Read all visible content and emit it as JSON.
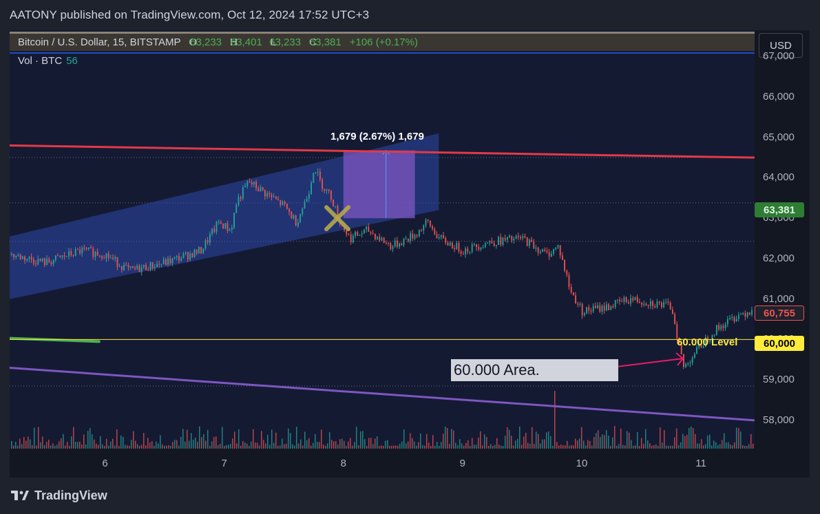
{
  "header": {
    "title": "AATONY published on TradingView.com, Oct 12, 2024 17:52 UTC+3"
  },
  "legend": {
    "symbol": "Bitcoin / U.S. Dollar, 15, BITSTAMP",
    "o_label": "O",
    "o_value": "63,233",
    "h_label": "H",
    "h_value": "63,401",
    "l_label": "L",
    "l_value": "63,233",
    "c_label": "C",
    "c_value": "63,381",
    "change": "+106 (+0.17%)"
  },
  "volume_legend": {
    "label": "Vol · BTC",
    "value": "56"
  },
  "currency_button": "USD",
  "price_ticks": [
    "67,000",
    "66,000",
    "65,000",
    "64,000",
    "63,000",
    "62,000",
    "61,000",
    "60,000",
    "59,000",
    "58,000"
  ],
  "time_ticks": [
    "6",
    "7",
    "8",
    "9",
    "10",
    "11"
  ],
  "badges": {
    "current": "63,381",
    "level_red": "60,755",
    "level_yellow": "60,000"
  },
  "annotations": {
    "measure": "1,679 (2.67%) 1,679",
    "level_60k": "60.000 Level",
    "area_note": "60.000 Area."
  },
  "footer": {
    "brand": "TradingView"
  },
  "colors": {
    "up": "#26a69a",
    "down": "#ef5350",
    "resistance_line": "#e53946",
    "support_line": "#7e57c2",
    "green_line": "#4caf50",
    "level_line": "#ffeb3b",
    "channel_fill": "#2c49a8",
    "measure_box": "#7e57c2",
    "arrow": "#e91e63",
    "cross": "#b6a84a"
  },
  "chart_data": {
    "type": "candlestick",
    "symbol": "BTC/USD",
    "timeframe": "15",
    "exchange": "BITSTAMP",
    "x_range_days": [
      5.2,
      11.45
    ],
    "y_range": [
      57300,
      67650
    ],
    "current_price": 63381,
    "price_path": [
      [
        5.2,
        62100
      ],
      [
        5.5,
        61900
      ],
      [
        5.8,
        62200
      ],
      [
        6.0,
        62100
      ],
      [
        6.2,
        61700
      ],
      [
        6.5,
        61900
      ],
      [
        6.8,
        62200
      ],
      [
        6.95,
        62900
      ],
      [
        7.05,
        62700
      ],
      [
        7.1,
        63400
      ],
      [
        7.2,
        63900
      ],
      [
        7.35,
        63600
      ],
      [
        7.5,
        63300
      ],
      [
        7.6,
        62900
      ],
      [
        7.7,
        63600
      ],
      [
        7.75,
        64300
      ],
      [
        7.8,
        63900
      ],
      [
        7.9,
        63500
      ],
      [
        7.95,
        63000
      ],
      [
        8.05,
        62500
      ],
      [
        8.2,
        62700
      ],
      [
        8.4,
        62300
      ],
      [
        8.6,
        62600
      ],
      [
        8.7,
        62900
      ],
      [
        8.8,
        62500
      ],
      [
        9.0,
        62200
      ],
      [
        9.2,
        62400
      ],
      [
        9.5,
        62500
      ],
      [
        9.7,
        62100
      ],
      [
        9.8,
        62300
      ],
      [
        9.9,
        61200
      ],
      [
        10.0,
        60700
      ],
      [
        10.2,
        60800
      ],
      [
        10.4,
        61000
      ],
      [
        10.6,
        60900
      ],
      [
        10.75,
        60800
      ],
      [
        10.85,
        59300
      ],
      [
        10.95,
        59700
      ],
      [
        11.1,
        60200
      ],
      [
        11.3,
        60600
      ],
      [
        11.45,
        60755
      ]
    ],
    "horizontal_levels": [
      {
        "price": 60000,
        "label": "60.000 Level"
      }
    ],
    "trendlines": [
      {
        "name": "",
        "from": [
          5.2,
          64800
        ],
        "to": [
          11.45,
          64500
        ]
      },
      {
        "name": "",
        "from": [
          5.2,
          59300
        ],
        "to": [
          11.45,
          58000
        ]
      },
      {
        "name": "",
        "from": [
          5.2,
          60030
        ],
        "to": [
          5.95,
          59950
        ]
      }
    ],
    "channel": {
      "from_x": 5.2,
      "to_x": 8.8,
      "lower_start": 61000,
      "lower_end": 63200,
      "upper_start": 62550,
      "upper_end": 65100
    },
    "measure": {
      "x0": 8.0,
      "x1": 8.6,
      "y0": 63000,
      "y1": 64679,
      "label": "1,679 (2.67%) 1,679"
    }
  }
}
